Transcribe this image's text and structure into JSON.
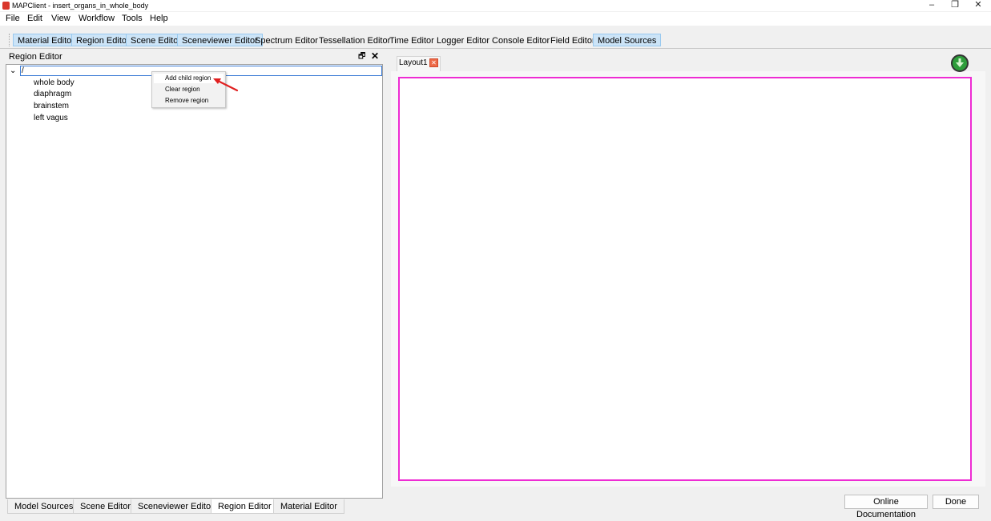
{
  "window": {
    "title": "MAPClient - insert_organs_in_whole_body",
    "minimize_glyph": "–",
    "restore_glyph": "❐",
    "close_glyph": "✕"
  },
  "menu": [
    "File",
    "Edit",
    "View",
    "Workflow",
    "Tools",
    "Help"
  ],
  "toolbar": [
    {
      "label": "Material Editor",
      "active": true
    },
    {
      "label": "Region Editor",
      "active": true
    },
    {
      "label": "Scene Editor",
      "active": true
    },
    {
      "label": "Sceneviewer Editor",
      "active": true
    },
    {
      "label": "Spectrum Editor",
      "active": false
    },
    {
      "label": "Tessellation Editor",
      "active": false
    },
    {
      "label": "Time Editor",
      "active": false
    },
    {
      "label": "Logger Editor",
      "active": false
    },
    {
      "label": "Console Editor",
      "active": false
    },
    {
      "label": "Field Editor",
      "active": false
    },
    {
      "label": "Model Sources",
      "active": true
    }
  ],
  "region_editor": {
    "title": "Region Editor",
    "float_glyph": "🗗",
    "close_glyph": "✕",
    "root": {
      "chevron": "⌄",
      "label": "/"
    },
    "children": [
      "whole body",
      "diaphragm",
      "brainstem",
      "left vagus"
    ]
  },
  "context_menu": {
    "items": [
      "Add child region",
      "Clear region",
      "Remove region"
    ],
    "highlighted_index": 0
  },
  "bottom_tabs": [
    {
      "label": "Model Sources",
      "active": false
    },
    {
      "label": "Scene Editor",
      "active": false
    },
    {
      "label": "Sceneviewer Editor",
      "active": false
    },
    {
      "label": "Region Editor",
      "active": true
    },
    {
      "label": "Material Editor",
      "active": false
    }
  ],
  "layout": {
    "tab_label": "Layout1",
    "tab_close_glyph": "✕",
    "canvas_border_color": "#ee2cd3",
    "go_icon": "download-arrow-icon"
  },
  "footer": {
    "online_docs_label": "Online Documentation",
    "done_label": "Done"
  },
  "colors": {
    "active_tab_bg": "#cce4f7",
    "canvas_border": "#ee2cd3",
    "annotation_arrow": "#e02020"
  }
}
